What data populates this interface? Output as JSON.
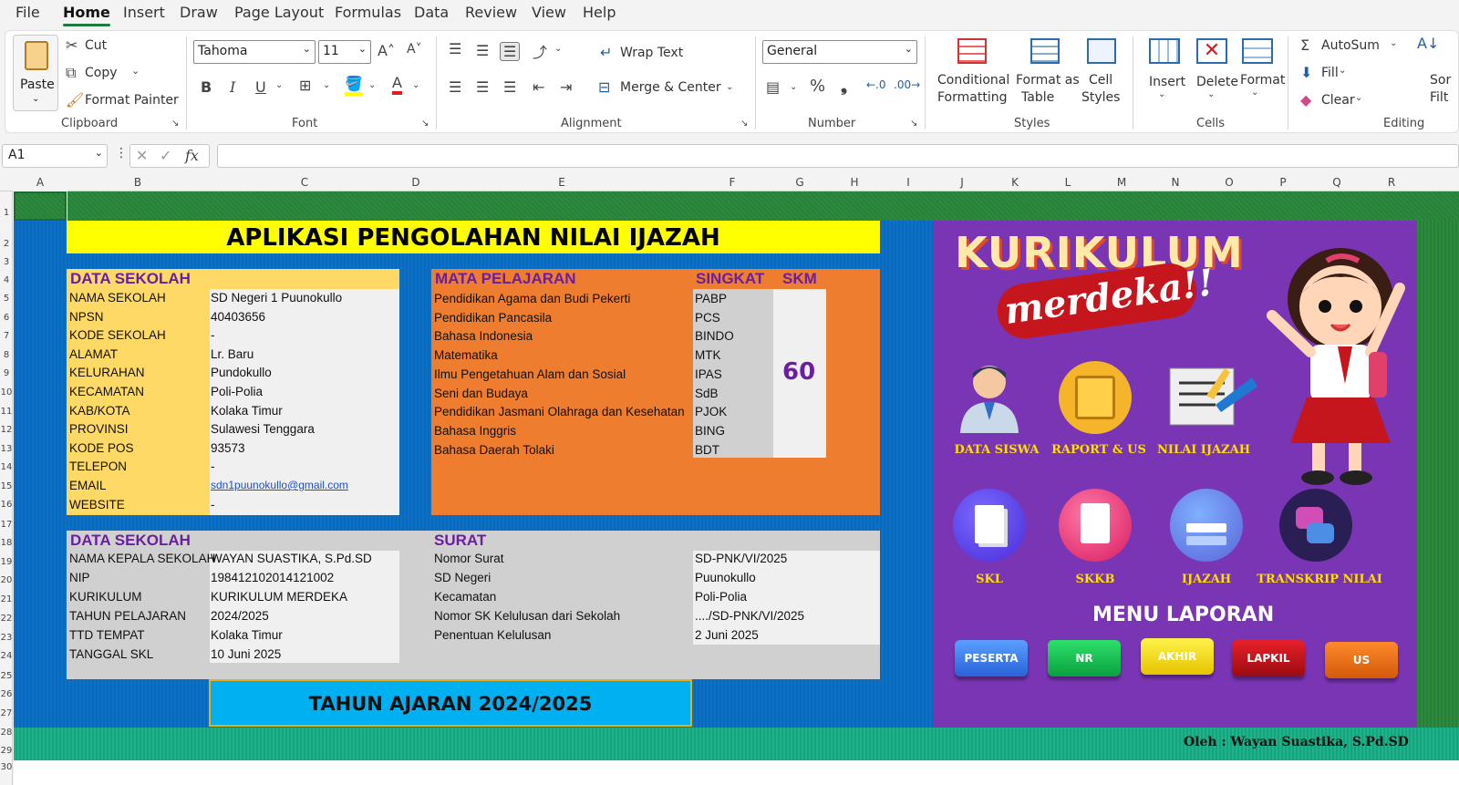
{
  "menu": {
    "tabs": [
      "File",
      "Home",
      "Insert",
      "Draw",
      "Page Layout",
      "Formulas",
      "Data",
      "Review",
      "View",
      "Help"
    ],
    "active": "Home"
  },
  "ribbon": {
    "clipboard": {
      "paste": "Paste",
      "cut": "Cut",
      "copy": "Copy",
      "format_painter": "Format Painter",
      "group": "Clipboard"
    },
    "font": {
      "name": "Tahoma",
      "size": "11",
      "group": "Font",
      "bold": "B",
      "italic": "I",
      "underline": "U"
    },
    "alignment": {
      "wrap": "Wrap Text",
      "merge": "Merge & Center",
      "group": "Alignment"
    },
    "number": {
      "format": "General",
      "group": "Number"
    },
    "styles": {
      "conditional_1": "Conditional",
      "conditional_2": "Formatting",
      "format_table_1": "Format as",
      "format_table_2": "Table",
      "cell_styles_1": "Cell",
      "cell_styles_2": "Styles",
      "group": "Styles"
    },
    "cells": {
      "insert": "Insert",
      "delete": "Delete",
      "format": "Format",
      "group": "Cells"
    },
    "editing": {
      "autosum": "AutoSum",
      "fill": "Fill",
      "clear": "Clear",
      "sort_1": "Sor",
      "sort_2": "Filt",
      "group": "Editing"
    }
  },
  "formula_bar": {
    "name_box": "A1",
    "fx": "fx",
    "value": ""
  },
  "columns": [
    "A",
    "B",
    "C",
    "D",
    "E",
    "F",
    "G",
    "H",
    "I",
    "J",
    "K",
    "L",
    "M",
    "N",
    "O",
    "P",
    "Q",
    "R"
  ],
  "rows": [
    "1",
    "2",
    "3",
    "4",
    "5",
    "6",
    "7",
    "8",
    "9",
    "10",
    "11",
    "12",
    "13",
    "14",
    "15",
    "16",
    "17",
    "18",
    "19",
    "20",
    "21",
    "22",
    "23",
    "24",
    "25",
    "26",
    "27",
    "28",
    "29",
    "30"
  ],
  "app": {
    "title": "APLIKASI PENGOLAHAN NILAI IJAZAH",
    "footer_year": "TAHUN AJARAN 2024/2025",
    "credit": "Oleh : Wayan Suastika, S.Pd.SD"
  },
  "data_sekolah": {
    "header": "DATA SEKOLAH",
    "rows": [
      {
        "label": "NAMA SEKOLAH",
        "value": "SD Negeri 1 Puunokullo"
      },
      {
        "label": "NPSN",
        "value": "40403656"
      },
      {
        "label": "KODE SEKOLAH",
        "value": "-"
      },
      {
        "label": "ALAMAT",
        "value": "Lr. Baru"
      },
      {
        "label": "KELURAHAN",
        "value": "Pundokullo"
      },
      {
        "label": "KECAMATAN",
        "value": "Poli-Polia"
      },
      {
        "label": "KAB/KOTA",
        "value": "Kolaka Timur"
      },
      {
        "label": "PROVINSI",
        "value": "Sulawesi Tenggara"
      },
      {
        "label": "KODE POS",
        "value": "93573"
      },
      {
        "label": "TELEPON",
        "value": "-"
      },
      {
        "label": "EMAIL",
        "value": "sdn1puunokullo@gmail.com"
      },
      {
        "label": "WEBSITE",
        "value": "-"
      }
    ]
  },
  "mata_pelajaran": {
    "header": "MATA PELAJARAN",
    "header_singkat": "SINGKAT",
    "header_skm": "SKM",
    "skm": "60",
    "rows": [
      {
        "name": "Pendidikan Agama dan Budi Pekerti",
        "abbr": "PABP"
      },
      {
        "name": "Pendidikan Pancasila",
        "abbr": "PCS"
      },
      {
        "name": "Bahasa Indonesia",
        "abbr": "BINDO"
      },
      {
        "name": "Matematika",
        "abbr": "MTK"
      },
      {
        "name": "Ilmu Pengetahuan Alam dan Sosial",
        "abbr": "IPAS"
      },
      {
        "name": "Seni dan Budaya",
        "abbr": "SdB"
      },
      {
        "name": "Pendidikan Jasmani Olahraga dan Kesehatan",
        "abbr": "PJOK"
      },
      {
        "name": "Bahasa Inggris",
        "abbr": "BING"
      },
      {
        "name": "Bahasa Daerah Tolaki",
        "abbr": "BDT"
      }
    ]
  },
  "data_sekolah2": {
    "header": "DATA SEKOLAH",
    "rows": [
      {
        "label": "NAMA KEPALA SEKOLAH",
        "value": "WAYAN SUASTIKA, S.Pd.SD"
      },
      {
        "label": "NIP",
        "value": "198412102014121002"
      },
      {
        "label": "KURIKULUM",
        "value": "KURIKULUM MERDEKA"
      },
      {
        "label": "TAHUN PELAJARAN",
        "value": "2024/2025"
      },
      {
        "label": "TTD TEMPAT",
        "value": "Kolaka Timur"
      },
      {
        "label": "TANGGAL SKL",
        "value": "10 Juni 2025"
      }
    ]
  },
  "surat": {
    "header": "SURAT",
    "rows": [
      {
        "label": "Nomor Surat",
        "value": "SD-PNK/VI/2025"
      },
      {
        "label": "SD Negeri",
        "value": "Puunokullo"
      },
      {
        "label": "Kecamatan",
        "value": "Poli-Polia"
      },
      {
        "label": "Nomor SK Kelulusan dari Sekolah",
        "value": "..../SD-PNK/VI/2025"
      },
      {
        "label": "Penentuan Kelulusan",
        "value": "2 Juni 2025"
      }
    ]
  },
  "kurikulum": {
    "title1": "KURIKULUM",
    "title2": "merdeka!!",
    "menu_top": [
      "DATA SISWA",
      "RAPORT & US",
      "NILAI IJAZAH"
    ],
    "menu_mid": [
      "SKL",
      "SKKB",
      "IJAZAH",
      "TRANSKRIP NILAI"
    ],
    "menu_laporan": "MENU LAPORAN",
    "laporan_buttons": [
      "PESERTA",
      "NR",
      "AKHIR",
      "LAPKIL",
      "US"
    ]
  },
  "colors": {
    "green_band": "#2e8b3e",
    "blue_bg": "#0a73c9",
    "purple_panel": "#7a35b5",
    "yellow_title": "#ffff00",
    "orange_panel": "#ee7d30",
    "cyan_box": "#00b0f0",
    "teal_footer": "#1fb38c"
  }
}
